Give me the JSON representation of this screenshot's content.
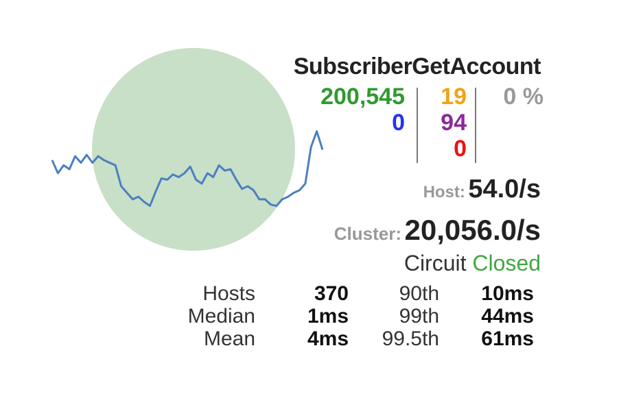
{
  "circuit": {
    "name": "SubscriberGetAccount",
    "counts": {
      "success": "200,545",
      "short_circuited": "0",
      "timeout": "19",
      "rejected": "94",
      "failure": "0",
      "error_percentage": "0 %"
    },
    "host_rate": {
      "label": "Host:",
      "value": "54.0/s"
    },
    "cluster_rate": {
      "label": "Cluster:",
      "value": "20,056.0/s"
    },
    "status": {
      "prefix": "Circuit",
      "state": "Closed"
    },
    "stats": {
      "labels_left": [
        "Hosts",
        "Median",
        "Mean"
      ],
      "values_left": [
        "370",
        "1ms",
        "4ms"
      ],
      "labels_right": [
        "90th",
        "99th",
        "99.5th"
      ],
      "values_right": [
        "10ms",
        "44ms",
        "61ms"
      ]
    }
  },
  "colors": {
    "success": "#2f9a2f",
    "short_circuited": "#2233ee",
    "timeout": "#f0a315",
    "rejected": "#8c2a9a",
    "failure": "#ee1111",
    "error_percentage": "#999999",
    "circle_fill": "#c8dfc8",
    "sparkline": "#4a7fc1",
    "closed": "#41a741"
  },
  "sparkline": [
    40,
    30,
    36,
    33,
    43,
    38,
    44,
    38,
    43,
    40,
    38,
    36,
    20,
    15,
    10,
    12,
    8,
    5,
    16,
    26,
    25,
    29,
    27,
    30,
    35,
    25,
    22,
    30,
    27,
    36,
    32,
    33,
    25,
    18,
    20,
    17,
    10,
    10,
    6,
    5,
    10,
    12,
    15,
    17,
    22,
    50,
    62,
    48
  ]
}
